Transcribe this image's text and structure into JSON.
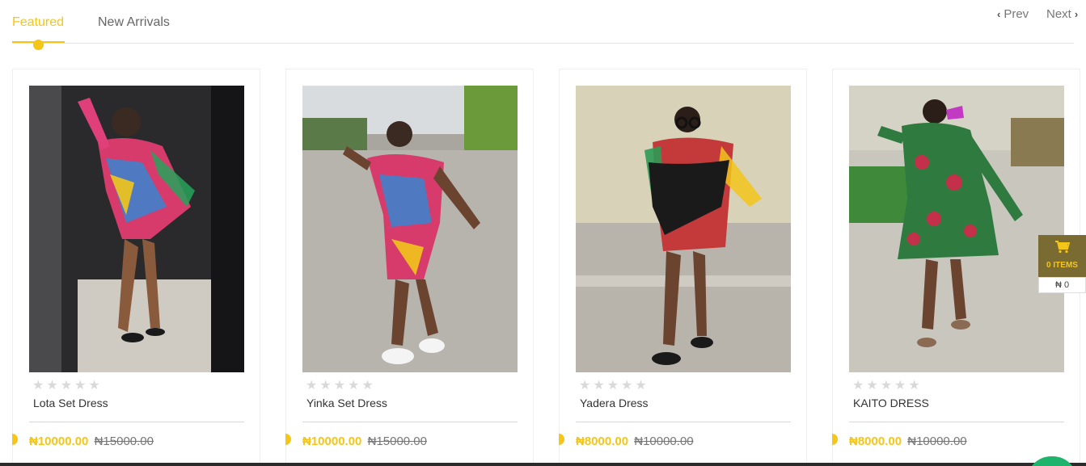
{
  "tabs": {
    "featured": "Featured",
    "new_arrivals": "New Arrivals"
  },
  "pager": {
    "prev": "Prev",
    "next": "Next"
  },
  "products": [
    {
      "name": "Lota Set Dress",
      "price": "₦10000.00",
      "old_price": "₦15000.00",
      "rating": 0
    },
    {
      "name": "Yinka Set Dress",
      "price": "₦10000.00",
      "old_price": "₦15000.00",
      "rating": 0
    },
    {
      "name": "Yadera Dress",
      "price": "₦8000.00",
      "old_price": "₦10000.00",
      "rating": 0
    },
    {
      "name": "KAITO DRESS",
      "price": "₦8000.00",
      "old_price": "₦10000.00",
      "rating": 0
    }
  ],
  "cart": {
    "items_label": "0 ITEMS",
    "total": "₦ 0",
    "icon": "shopping-cart-icon"
  },
  "colors": {
    "accent": "#f5c518",
    "cart_bg": "#7a6b32",
    "chat": "#1eb46b"
  }
}
